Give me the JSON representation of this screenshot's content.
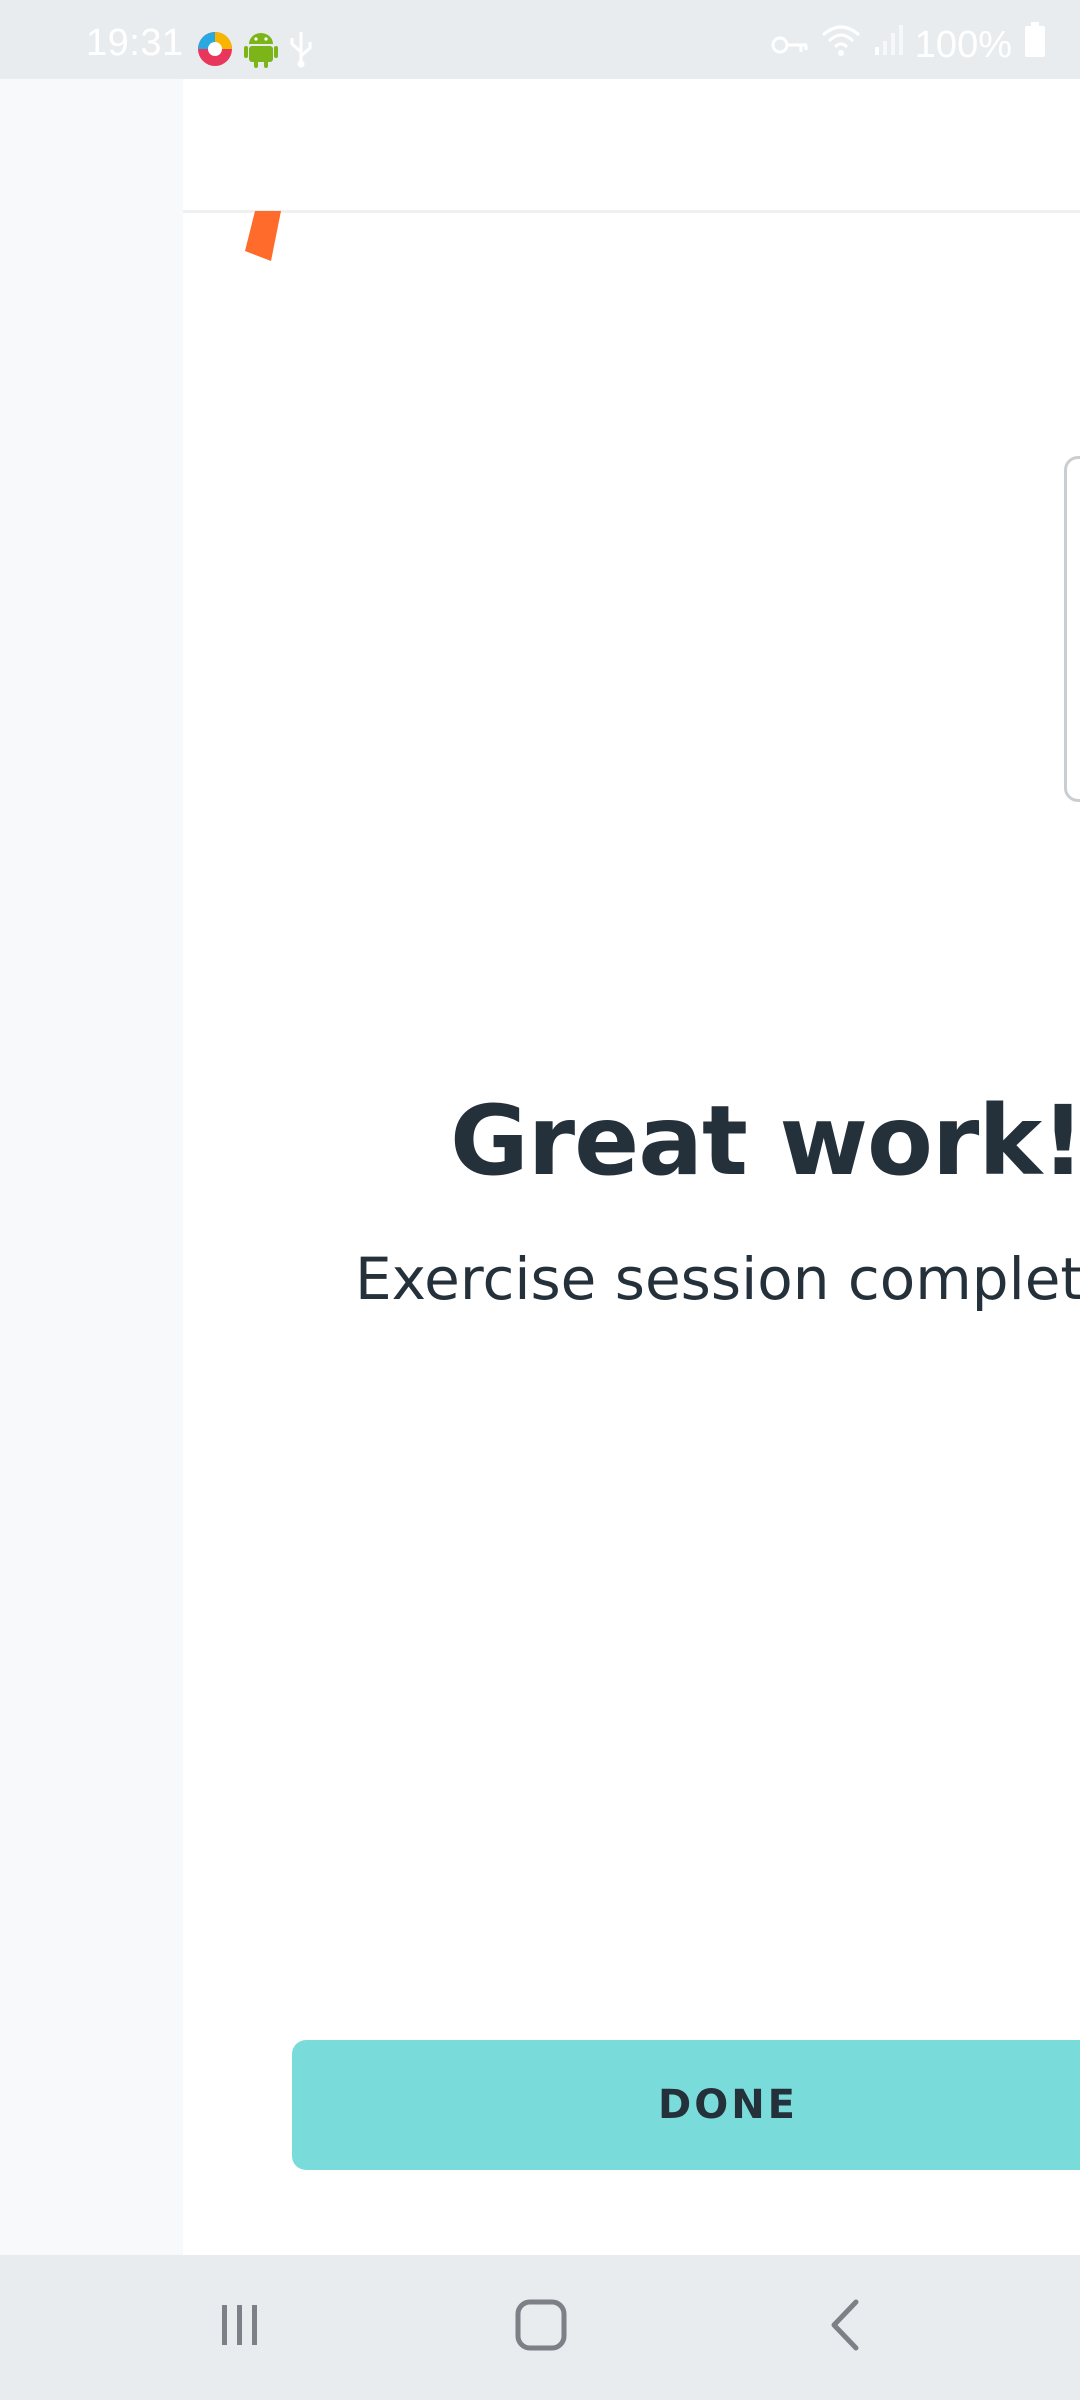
{
  "status_bar": {
    "time": "19:31",
    "battery_text": "100%",
    "left_icons": [
      "app-notification-icon",
      "android-icon",
      "usb-icon"
    ],
    "right_icons": [
      "vpn-key-icon",
      "wifi-icon",
      "signal-icon",
      "battery-icon"
    ]
  },
  "main": {
    "title": "Great work!",
    "subtitle": "Exercise session complete"
  },
  "actions": {
    "done_label": "DONE"
  },
  "nav_bar": {
    "buttons": [
      "recent-apps-icon",
      "home-icon",
      "back-icon"
    ]
  },
  "colors": {
    "accent": "#7adcda",
    "text": "#25313a",
    "confetti": "#ff6b2b",
    "system_bar": "#e9ecef"
  }
}
